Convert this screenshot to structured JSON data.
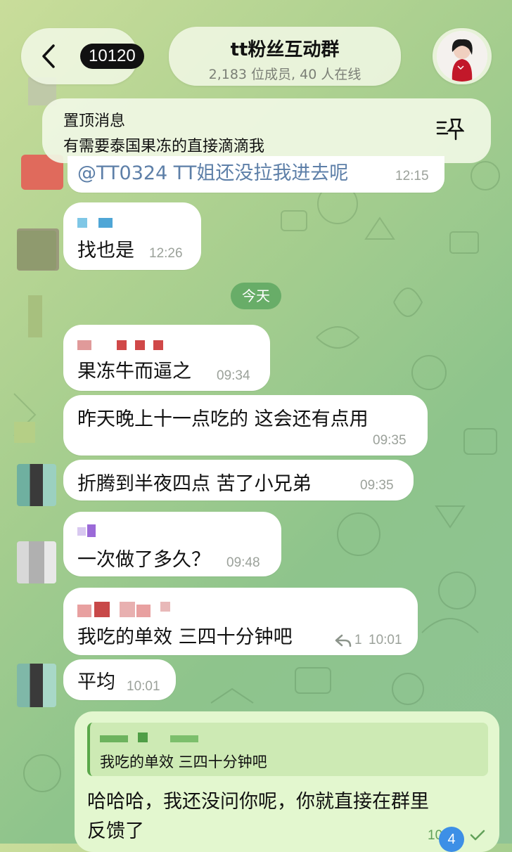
{
  "header": {
    "back_count": "10120",
    "title": "tt粉丝互动群",
    "subtitle": "2,183 位成员, 40 人在线"
  },
  "pinned": {
    "label": "置顶消息",
    "text": "有需要泰国果冻的直接滴滴我"
  },
  "date_chip": "今天",
  "messages": [
    {
      "text": "@TT0324 TT姐还没拉我进去呢",
      "time": "12:15"
    },
    {
      "text": "找也是",
      "time": "12:26"
    },
    {
      "text": "果冻牛而逼之",
      "time": "09:34"
    },
    {
      "text": "昨天晚上十一点吃的 这会还有点用",
      "time": "09:35"
    },
    {
      "text": "折腾到半夜四点  苦了小兄弟",
      "time": "09:35"
    },
    {
      "text": "一次做了多久？",
      "time": "09:48"
    },
    {
      "text": "我吃的单效  三四十分钟吧",
      "time": "10:01",
      "reply_count": "1"
    },
    {
      "text": "平均",
      "time": "10:01"
    }
  ],
  "own_message": {
    "quoted_text": "我吃的单效 三四十分钟吧",
    "line1": "哈哈哈，我还没问你呢，你就直接在群里",
    "line2": "反馈了",
    "time": "10:02",
    "unread_badge": "4"
  },
  "colors": {
    "bubble": "#ffffff",
    "own_bubble": "#e3f7cf",
    "accent": "#68ad68"
  },
  "icons": [
    "chevron-left-icon",
    "pin-icon",
    "reply-icon",
    "check-icon"
  ]
}
